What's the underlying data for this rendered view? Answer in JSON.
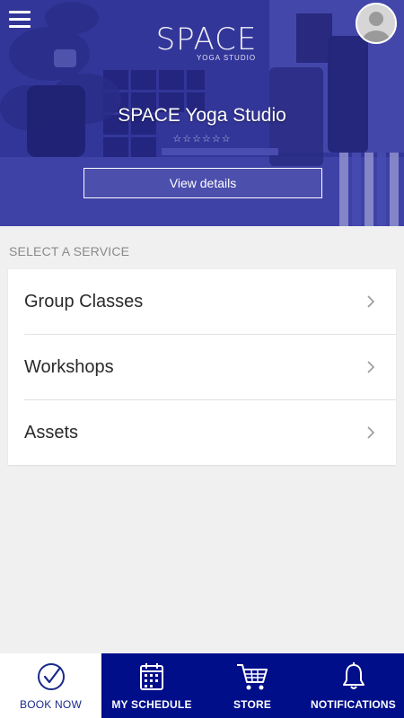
{
  "hero": {
    "logo_word": "SPACE",
    "logo_sub": "YOGA STUDIO",
    "studio_name": "SPACE Yoga Studio",
    "rating_stars": "☆☆☆☆☆☆",
    "view_details_label": "View details"
  },
  "icons": {
    "menu": "hamburger-menu-icon",
    "avatar": "user-avatar-icon",
    "chevron": "chevron-right-icon"
  },
  "services": {
    "section_label": "SELECT A SERVICE",
    "items": [
      {
        "label": "Group Classes"
      },
      {
        "label": "Workshops"
      },
      {
        "label": "Assets"
      }
    ]
  },
  "bottom_nav": {
    "active_color": "#ffffff",
    "bar_color": "#000e8a",
    "tabs": [
      {
        "label": "BOOK NOW",
        "icon": "check-circle-icon",
        "active": true
      },
      {
        "label": "MY SCHEDULE",
        "icon": "calendar-icon",
        "active": false
      },
      {
        "label": "STORE",
        "icon": "shopping-cart-icon",
        "active": false
      },
      {
        "label": "NOTIFICATIONS",
        "icon": "bell-icon",
        "active": false
      }
    ]
  }
}
